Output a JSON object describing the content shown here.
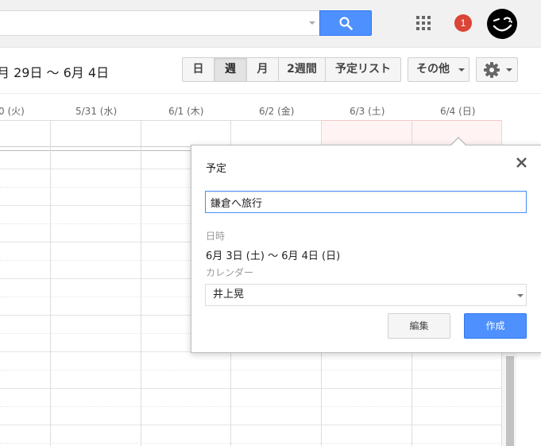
{
  "header": {
    "notification_count": "1"
  },
  "toolbar": {
    "date_range": "月 29日 ～ 6月 4日",
    "views": [
      {
        "label": "日",
        "active": false
      },
      {
        "label": "週",
        "active": true
      },
      {
        "label": "月",
        "active": false
      },
      {
        "label": "2週間",
        "active": false
      },
      {
        "label": "予定リスト",
        "active": false
      }
    ],
    "more_label": "その他"
  },
  "calendar": {
    "days": [
      {
        "label": "0 (火)",
        "weekend": false
      },
      {
        "label": "5/31 (水)",
        "weekend": false
      },
      {
        "label": "6/1 (木)",
        "weekend": false
      },
      {
        "label": "6/2 (金)",
        "weekend": false
      },
      {
        "label": "6/3 (土)",
        "weekend": true
      },
      {
        "label": "6/4 (日)",
        "weekend": true
      }
    ],
    "weekend_color": "#fff3f3"
  },
  "bubble": {
    "title": "予定",
    "event_value": "鎌倉へ旅行",
    "datetime_label": "日時",
    "datetime_value": "6月 3日 (土) ～ 6月 4日 (日)",
    "calendar_label": "カレンダー",
    "calendar_value": "井上晃",
    "edit_label": "編集",
    "create_label": "作成"
  },
  "colors": {
    "accent": "#4d90fe",
    "notification": "#db4437"
  },
  "icons": {
    "search": "search-icon",
    "apps": "apps-grid-icon",
    "settings": "gear-icon",
    "close": "close-icon",
    "avatar": "winking-face-avatar"
  }
}
